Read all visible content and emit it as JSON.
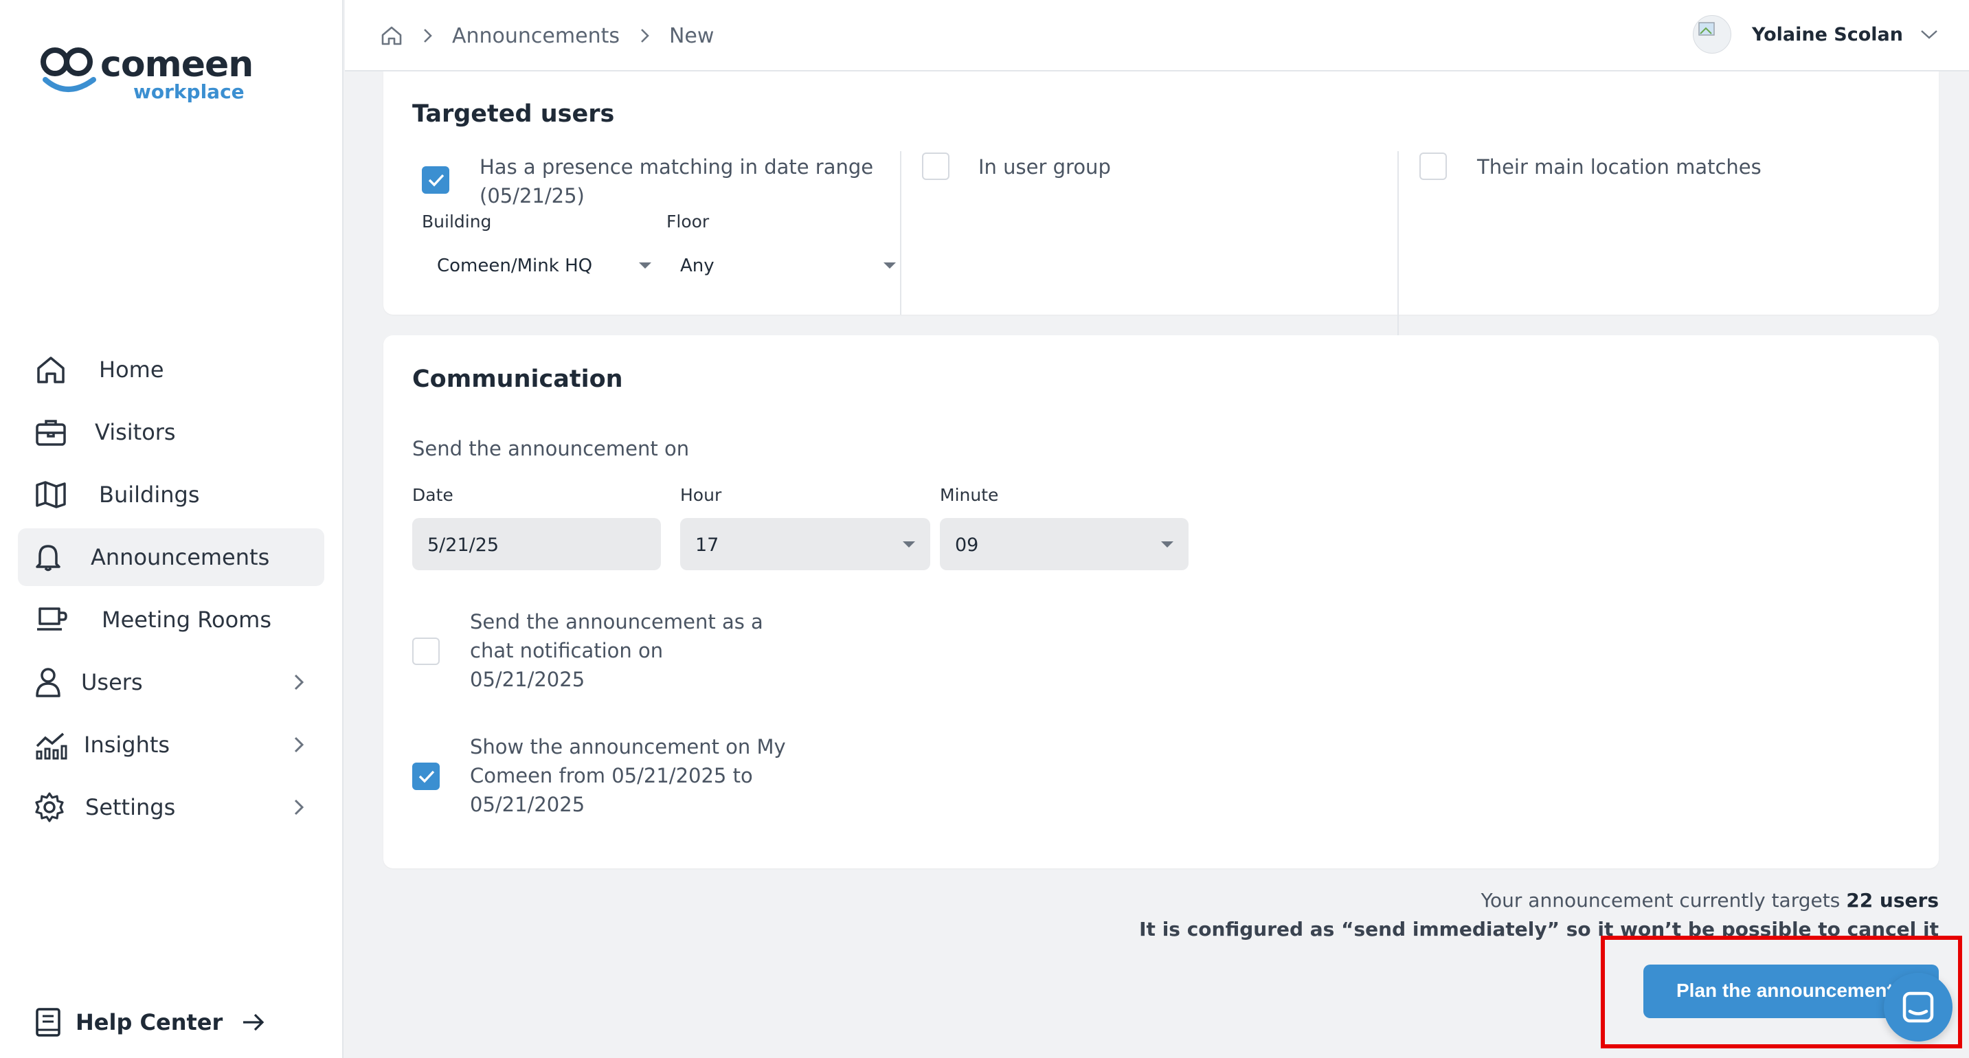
{
  "brand": {
    "name": "comeen",
    "sub": "workplace",
    "accent": "#3b8fd1"
  },
  "sidebar": {
    "items": [
      {
        "label": "Home",
        "icon": "home-icon"
      },
      {
        "label": "Visitors",
        "icon": "briefcase-icon"
      },
      {
        "label": "Buildings",
        "icon": "map-icon"
      },
      {
        "label": "Announcements",
        "icon": "bell-icon",
        "active": true
      },
      {
        "label": "Meeting Rooms",
        "icon": "meeting-room-icon"
      },
      {
        "label": "Users",
        "icon": "user-icon",
        "expandable": true
      },
      {
        "label": "Insights",
        "icon": "chart-icon",
        "expandable": true
      },
      {
        "label": "Settings",
        "icon": "gear-icon",
        "expandable": true
      }
    ],
    "help_label": "Help Center"
  },
  "breadcrumb": {
    "items": [
      "Announcements",
      "New"
    ]
  },
  "user": {
    "name": "Yolaine Scolan"
  },
  "targeted": {
    "title": "Targeted users",
    "presence": {
      "label_line1": "Has a presence matching in date range",
      "label_line2": "(05/21/25)",
      "checked": true
    },
    "building_label": "Building",
    "building_value": "Comeen/Mink HQ",
    "floor_label": "Floor",
    "floor_value": "Any",
    "group": {
      "label": "In user group",
      "checked": false
    },
    "location": {
      "label": "Their main location matches",
      "checked": false
    }
  },
  "communication": {
    "title": "Communication",
    "send_on_label": "Send the announcement on",
    "date_label": "Date",
    "date_value": "5/21/25",
    "hour_label": "Hour",
    "hour_value": "17",
    "minute_label": "Minute",
    "minute_value": "09",
    "chat": {
      "line1": "Send the announcement as a",
      "line2": "chat notification on",
      "line3": "05/21/2025",
      "checked": false
    },
    "mycomeen": {
      "line1": "Show the announcement on My",
      "line2": "Comeen from 05/21/2025 to",
      "line3": "05/21/2025",
      "checked": true
    }
  },
  "summary": {
    "targets_prefix": "Your announcement currently targets",
    "targets_count": "22 users",
    "warning": "It is configured as “send immediately” so it won’t be possible to cancel it"
  },
  "plan_button_label": "Plan the announcement"
}
